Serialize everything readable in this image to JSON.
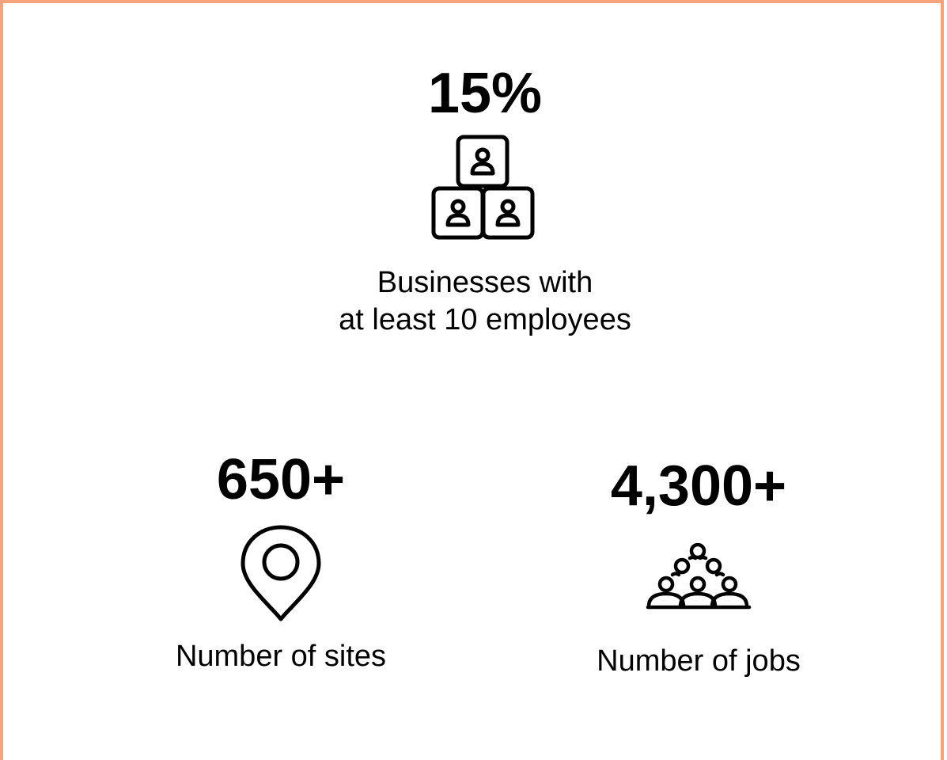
{
  "stats": [
    {
      "value": "15%",
      "label_line1": "Businesses with",
      "label_line2": "at least 10 employees",
      "icon": "employee-boxes-icon"
    },
    {
      "value": "650+",
      "label": "Number of sites",
      "icon": "location-pin-icon"
    },
    {
      "value": "4,300+",
      "label": "Number of jobs",
      "icon": "crowd-icon"
    }
  ],
  "colors": {
    "border": "#F4A37C",
    "text": "#000000",
    "background": "#FFFFFF"
  }
}
